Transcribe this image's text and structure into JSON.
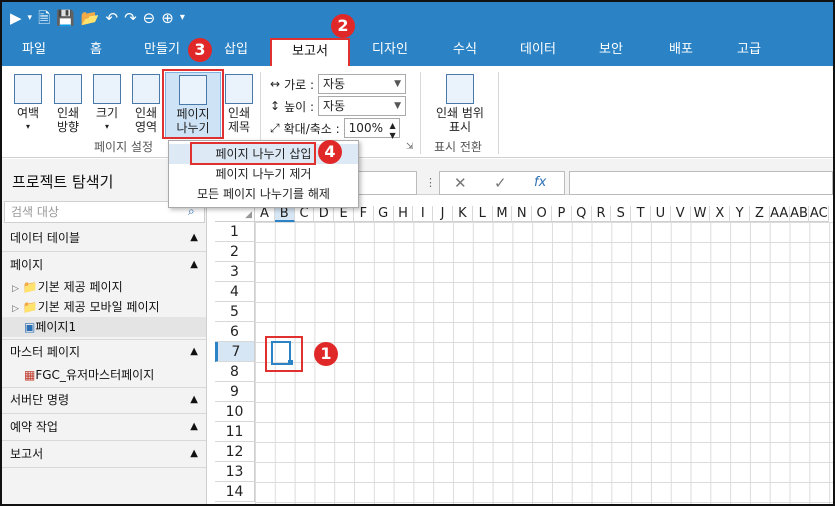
{
  "tabs": [
    "파일",
    "홈",
    "만들기",
    "삽입",
    "보고서",
    "디자인",
    "수식",
    "데이터",
    "보안",
    "배포",
    "고급"
  ],
  "active_tab": "보고서",
  "ribbon": {
    "margin": [
      "여백"
    ],
    "orientation": [
      "인쇄",
      "방향"
    ],
    "size": [
      "크기"
    ],
    "print_area": [
      "인쇄",
      "영역"
    ],
    "page_break": [
      "페이지",
      "나누기"
    ],
    "print_title": [
      "인쇄",
      "제목"
    ],
    "page_setup_label": "페이지 설정",
    "width_label": "가로 :",
    "width_value": "자동",
    "height_label": "높이 :",
    "height_value": "자동",
    "zoom_label": "확대/축소 :",
    "zoom_value": "100%",
    "print_range": [
      "인쇄 범위",
      "표시"
    ],
    "display_switch_label": "표시 전환"
  },
  "dropdown": [
    "페이지 나누기 삽입",
    "페이지 나누기 제거",
    "모든 페이지 나누기를 해제"
  ],
  "explorer": {
    "title": "프로젝트 탐색기",
    "search_placeholder": "검색 대상",
    "sections": [
      {
        "label": "데이터 테이블"
      },
      {
        "label": "페이지"
      },
      {
        "label": "기본 제공 페이지",
        "child": true
      },
      {
        "label": "기본 제공 모바일 페이지",
        "child": true
      },
      {
        "label": "페이지1",
        "child": true
      },
      {
        "label": "마스터 페이지"
      },
      {
        "label": "FGC_유저마스터페이지",
        "child": true
      },
      {
        "label": "서버단 명령"
      },
      {
        "label": "예약 작업"
      },
      {
        "label": "보고서"
      }
    ]
  },
  "formula_bar": {
    "fx": "fx"
  },
  "grid": {
    "columns": [
      "A",
      "B",
      "C",
      "D",
      "E",
      "F",
      "G",
      "H",
      "I",
      "J",
      "K",
      "L",
      "M",
      "N",
      "O",
      "P",
      "Q",
      "R",
      "S",
      "T",
      "U",
      "V",
      "W",
      "X",
      "Y",
      "Z",
      "AA",
      "AB",
      "AC"
    ],
    "rows": [
      "1",
      "2",
      "3",
      "4",
      "5",
      "6",
      "7",
      "8",
      "9",
      "10",
      "11",
      "12",
      "13",
      "14"
    ],
    "selected_col": "B",
    "selected_row": "7"
  },
  "badges": [
    "1",
    "2",
    "3",
    "4"
  ]
}
